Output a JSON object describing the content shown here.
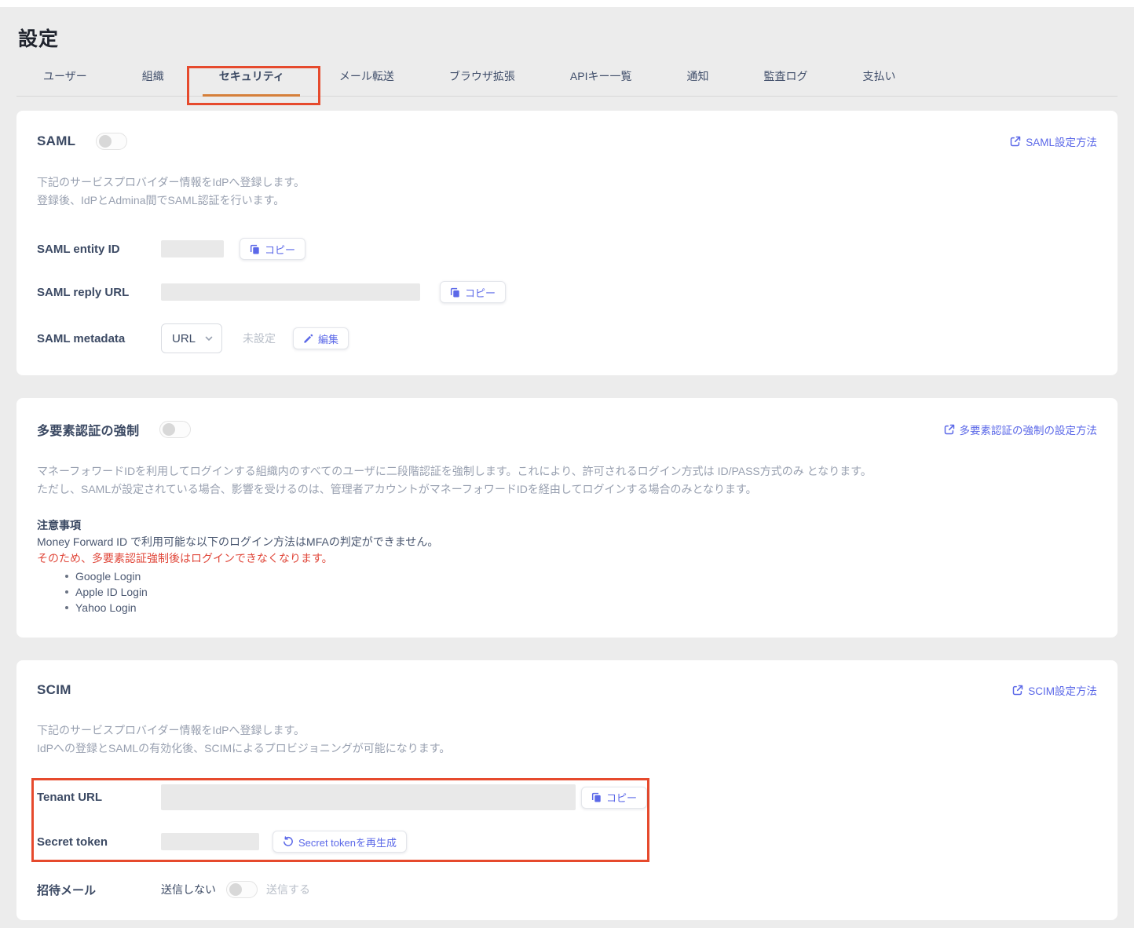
{
  "page": {
    "title": "設定"
  },
  "tabs": [
    {
      "label": "ユーザー",
      "active": false
    },
    {
      "label": "組織",
      "active": false
    },
    {
      "label": "セキュリティ",
      "active": true
    },
    {
      "label": "メール転送",
      "active": false
    },
    {
      "label": "ブラウザ拡張",
      "active": false
    },
    {
      "label": "APIキー一覧",
      "active": false
    },
    {
      "label": "通知",
      "active": false
    },
    {
      "label": "監査ログ",
      "active": false
    },
    {
      "label": "支払い",
      "active": false
    }
  ],
  "saml": {
    "title": "SAML",
    "toggle_state": "off",
    "link": "SAML設定方法",
    "desc1": "下記のサービスプロバイダー情報をIdPへ登録します。",
    "desc2": "登録後、IdPとAdmina間でSAML認証を行います。",
    "entity_id_label": "SAML entity ID",
    "reply_url_label": "SAML reply URL",
    "metadata_label": "SAML metadata",
    "metadata_select_value": "URL",
    "metadata_status": "未設定",
    "copy_label": "コピー",
    "edit_label": "編集"
  },
  "mfa": {
    "title": "多要素認証の強制",
    "toggle_state": "off",
    "link": "多要素認証の強制の設定方法",
    "desc1": "マネーフォワードIDを利用してログインする組織内のすべてのユーザに二段階認証を強制します。これにより、許可されるログイン方式は ID/PASS方式のみ となります。",
    "desc2": "ただし、SAMLが設定されている場合、影響を受けるのは、管理者アカウントがマネーフォワードIDを経由してログインする場合のみとなります。",
    "notes_title": "注意事項",
    "notes_line1": "Money Forward ID で利用可能な以下のログイン方法はMFAの判定ができません。",
    "notes_warning": "そのため、多要素認証強制後はログインできなくなります。",
    "login_methods": [
      "Google Login",
      "Apple ID Login",
      "Yahoo Login"
    ]
  },
  "scim": {
    "title": "SCIM",
    "link": "SCIM設定方法",
    "desc1": "下記のサービスプロバイダー情報をIdPへ登録します。",
    "desc2": "IdPへの登録とSAMLの有効化後、SCIMによるプロビジョニングが可能になります。",
    "tenant_url_label": "Tenant URL",
    "secret_token_label": "Secret token",
    "copy_label": "コピー",
    "regenerate_label": "Secret tokenを再生成",
    "invite_mail_label": "招待メール",
    "invite_off_label": "送信しない",
    "invite_on_label": "送信する",
    "invite_toggle_state": "off"
  },
  "colors": {
    "accent_link": "#5b68e8",
    "active_tab_underline": "#d57f3a",
    "annotation_red": "#e64a2d",
    "warning_text": "#e0473a",
    "background": "#ececec"
  }
}
